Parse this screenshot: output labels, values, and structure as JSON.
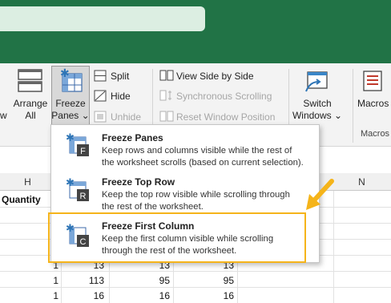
{
  "ribbon": {
    "w_partial": "w",
    "arrange_line1": "Arrange",
    "arrange_line2": "All",
    "freeze_line1": "Freeze",
    "freeze_line2": "Panes",
    "freeze_caret": "⌄",
    "split": "Split",
    "hide": "Hide",
    "unhide": "Unhide",
    "view_side_by_side": "View Side by Side",
    "synchronous_scrolling": "Synchronous Scrolling",
    "reset_window_position": "Reset Window Position",
    "switch_line1": "Switch",
    "switch_line2": "Windows",
    "switch_caret": "⌄",
    "macros": "Macros",
    "macros_group": "Macros"
  },
  "grid": {
    "col_h": "H",
    "col_n": "N",
    "header_cell": "Quantity",
    "rows": [
      {
        "a": "1",
        "b": "13",
        "c": "13",
        "d": "13"
      },
      {
        "a": "1",
        "b": "113",
        "c": "95",
        "d": "95"
      },
      {
        "a": "1",
        "b": "16",
        "c": "16",
        "d": "16"
      }
    ]
  },
  "menu": {
    "items": [
      {
        "title": "Freeze Panes",
        "desc1": "Keep rows and columns visible while the rest of",
        "desc2": "the worksheet scrolls (based on current selection).",
        "badge": "F"
      },
      {
        "title": "Freeze Top Row",
        "desc1": "Keep the top row visible while scrolling through",
        "desc2": "the rest of the worksheet.",
        "badge": "R"
      },
      {
        "title": "Freeze First Column",
        "desc1": "Keep the first column visible while scrolling",
        "desc2": "through the rest of the worksheet.",
        "badge": "C"
      }
    ]
  },
  "colors": {
    "title_bar": "#217346",
    "highlight": "#f5b41a",
    "icon_blue": "#2e75b6"
  }
}
